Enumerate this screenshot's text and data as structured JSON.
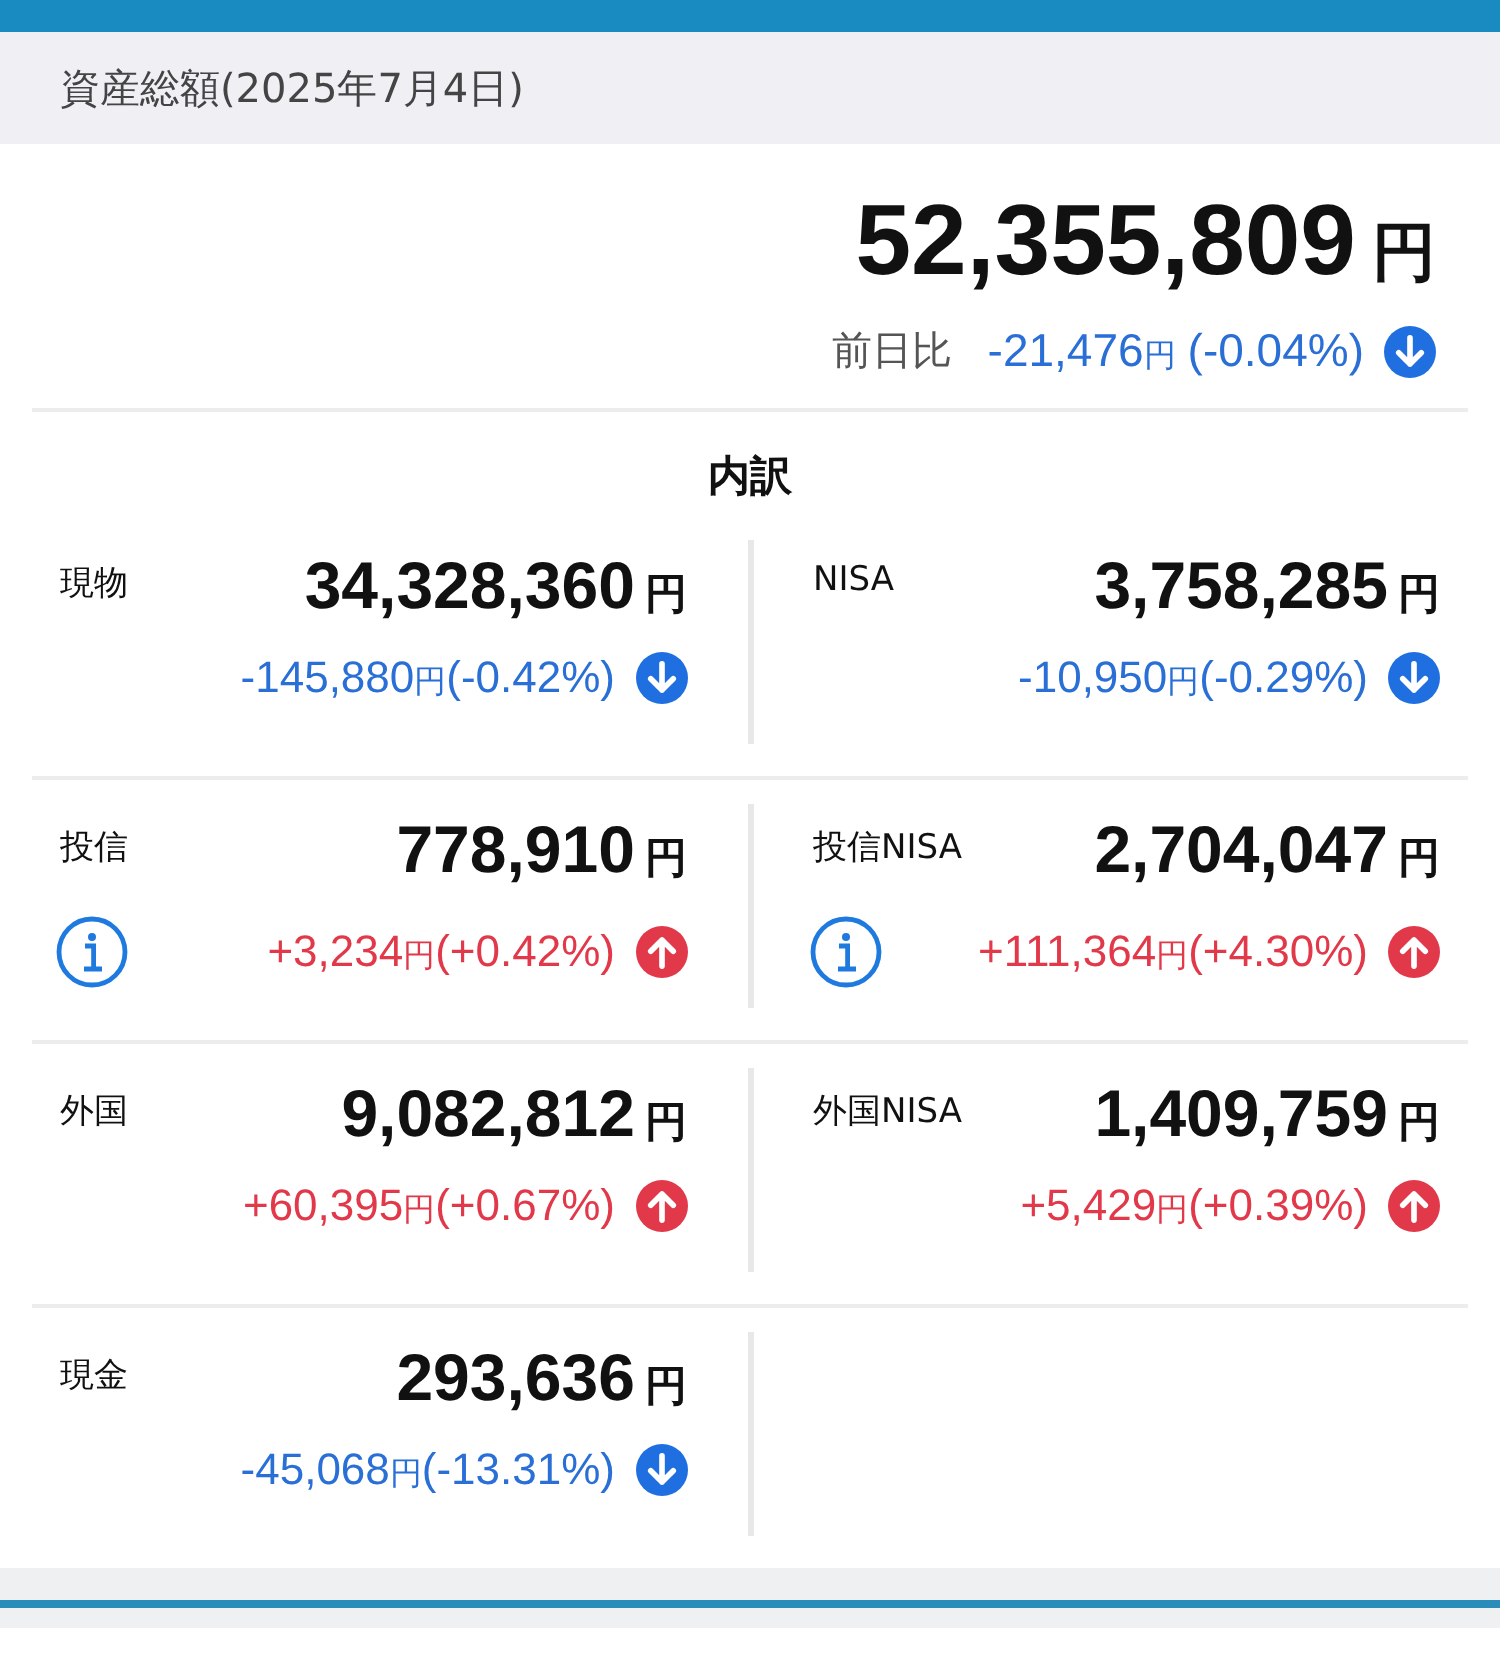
{
  "header": {
    "title": "資産総額(2025年7月4日)"
  },
  "total": {
    "amount": "52,355,809",
    "unit": "円",
    "compare_label": "前日比",
    "change": "-21,476",
    "change_unit": "円",
    "change_pct": "(-0.04%)",
    "rising": false
  },
  "breakdown_title": "内訳",
  "breakdown": [
    {
      "label": "現物",
      "amount": "34,328,360",
      "unit": "円",
      "change": "-145,880",
      "change_unit": "円",
      "change_pct": "(-0.42%)",
      "rising": false,
      "info": false
    },
    {
      "label": "NISA",
      "amount": "3,758,285",
      "unit": "円",
      "change": "-10,950",
      "change_unit": "円",
      "change_pct": "(-0.29%)",
      "rising": false,
      "info": false
    },
    {
      "label": "投信",
      "amount": "778,910",
      "unit": "円",
      "change": "+3,234",
      "change_unit": "円",
      "change_pct": "(+0.42%)",
      "rising": true,
      "info": true
    },
    {
      "label": "投信NISA",
      "amount": "2,704,047",
      "unit": "円",
      "change": "+111,364",
      "change_unit": "円",
      "change_pct": "(+4.30%)",
      "rising": true,
      "info": true
    },
    {
      "label": "外国",
      "amount": "9,082,812",
      "unit": "円",
      "change": "+60,395",
      "change_unit": "円",
      "change_pct": "(+0.67%)",
      "rising": true,
      "info": false
    },
    {
      "label": "外国NISA",
      "amount": "1,409,759",
      "unit": "円",
      "change": "+5,429",
      "change_unit": "円",
      "change_pct": "(+0.39%)",
      "rising": true,
      "info": false
    },
    {
      "label": "現金",
      "amount": "293,636",
      "unit": "円",
      "change": "-45,068",
      "change_unit": "円",
      "change_pct": "(-13.31%)",
      "rising": false,
      "info": false
    }
  ]
}
